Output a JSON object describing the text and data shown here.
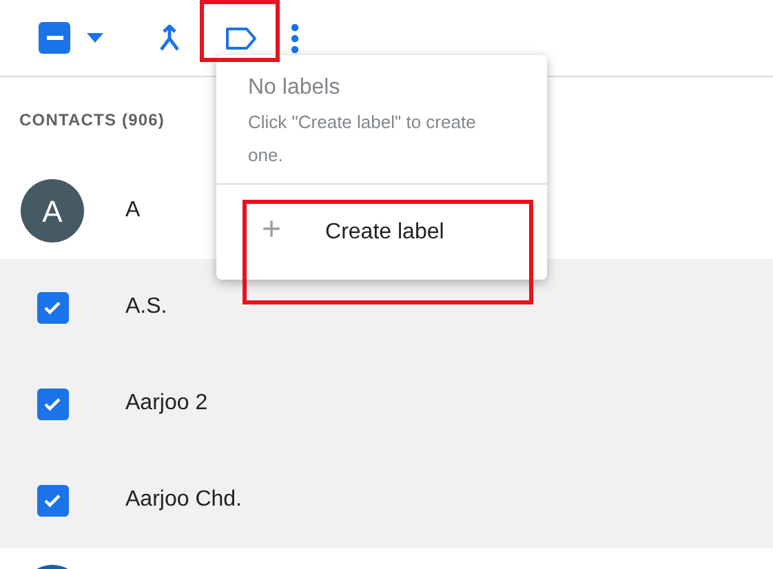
{
  "toolbar": {
    "select_all": {
      "indeterminate": true
    }
  },
  "header": "CONTACTS (906)",
  "contacts": [
    {
      "kind": "avatar",
      "initial": "A",
      "color": "#455a64",
      "name": "A",
      "selected": false
    },
    {
      "kind": "checkbox",
      "name": "A.S.",
      "selected": true
    },
    {
      "kind": "checkbox",
      "name": "Aarjoo 2",
      "selected": true
    },
    {
      "kind": "checkbox",
      "name": "Aarjoo Chd.",
      "selected": true
    },
    {
      "kind": "avatar",
      "color": "#1a5fa0",
      "selected": false
    }
  ],
  "label_menu": {
    "title": "No labels",
    "hint": "Click \"Create label\" to create one.",
    "action_icon": "+",
    "action": "Create label"
  }
}
